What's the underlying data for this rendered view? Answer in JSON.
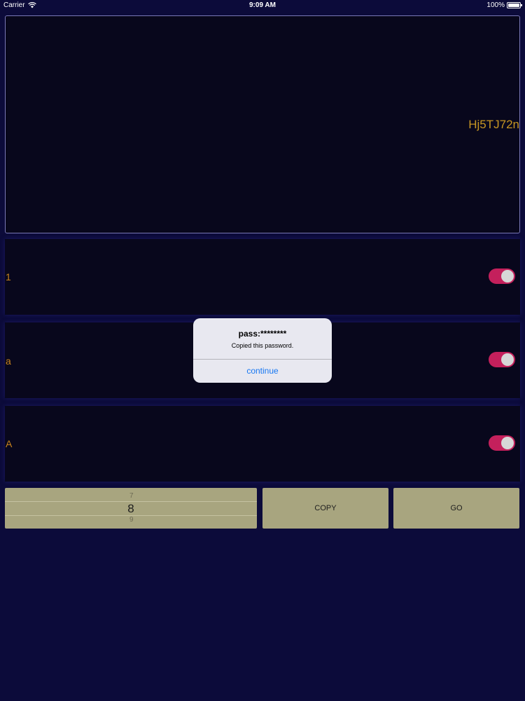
{
  "status_bar": {
    "carrier": "Carrier",
    "time": "9:09 AM",
    "battery": "100%",
    "battery_level": 1.0
  },
  "display": {
    "password": "Hj5TJ72n"
  },
  "options": [
    {
      "label": "1",
      "enabled": true
    },
    {
      "label": "a",
      "enabled": true
    },
    {
      "label": "A",
      "enabled": true
    }
  ],
  "length_picker": {
    "above": "7",
    "selected": "8",
    "below": "9"
  },
  "buttons": {
    "copy_label": "COPY",
    "go_label": "GO"
  },
  "alert": {
    "title": "pass:********",
    "message": "Copied this password.",
    "button_label": "continue"
  },
  "colors": {
    "background": "#0c0b3a",
    "panel": "#08071c",
    "accent_text": "#c8831c",
    "toggle_on": "#c4205c",
    "button_bg": "#a8a57f",
    "alert_link": "#1878f2"
  }
}
